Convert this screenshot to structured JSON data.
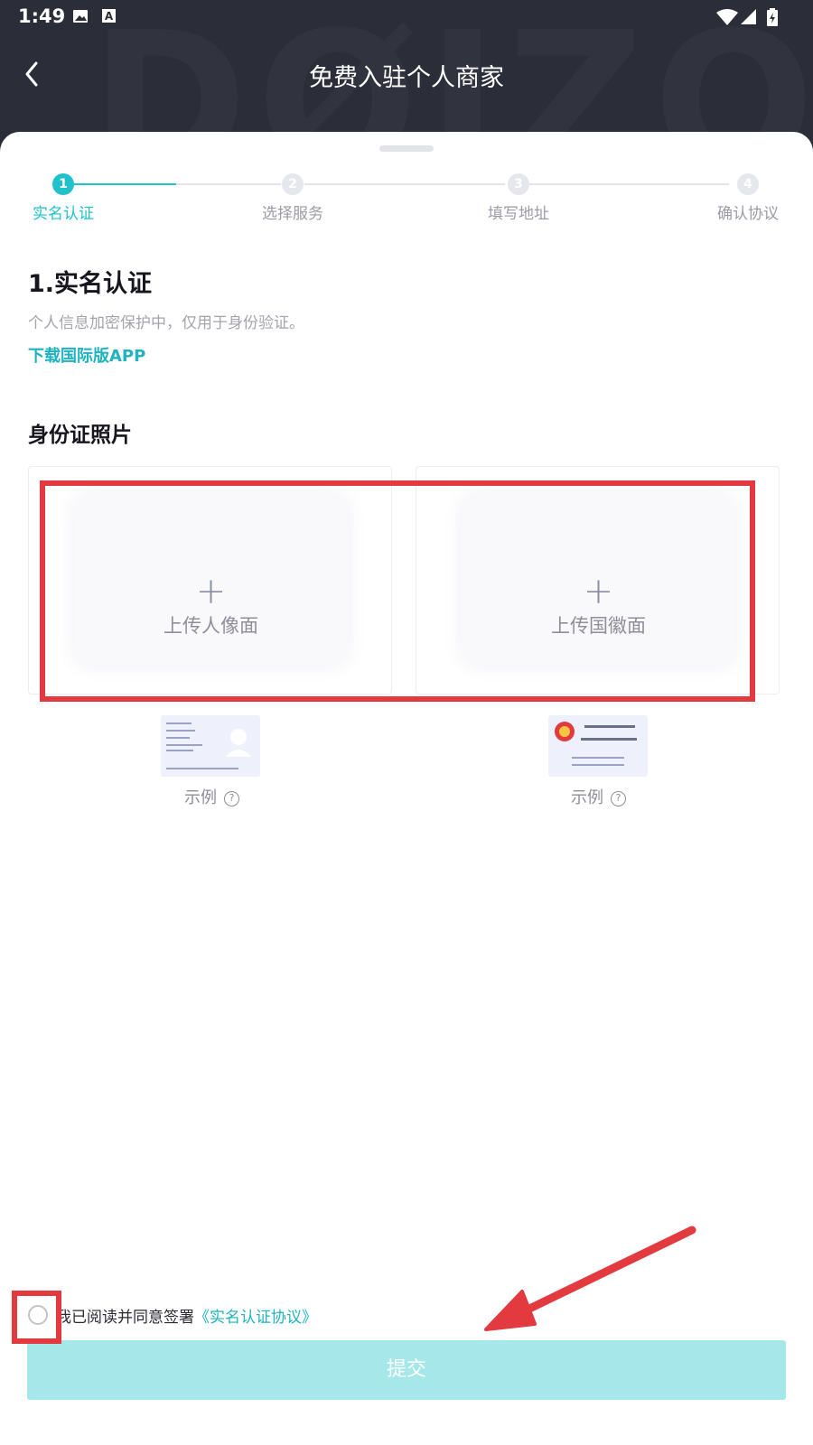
{
  "status_bar": {
    "time": "1:49",
    "icons": [
      "image-icon",
      "a-icon",
      "wifi-icon",
      "signal-icon",
      "battery-icon"
    ]
  },
  "header": {
    "title": "免费入驻个人商家",
    "back_icon": "chevron-left-icon"
  },
  "steps": [
    {
      "num": "1",
      "label": "实名认证",
      "active": true
    },
    {
      "num": "2",
      "label": "选择服务",
      "active": false
    },
    {
      "num": "3",
      "label": "填写地址",
      "active": false
    },
    {
      "num": "4",
      "label": "确认协议",
      "active": false
    }
  ],
  "section": {
    "title": "1.实名认证",
    "description": "个人信息加密保护中，仅用于身份验证。",
    "download_link": "下载国际版APP"
  },
  "id_photos": {
    "title": "身份证照片",
    "upload_front_label": "上传人像面",
    "upload_back_label": "上传国徽面",
    "example_label": "示例"
  },
  "agreement": {
    "text": "我已阅读并同意签署",
    "link": "《实名认证协议》",
    "checked": false
  },
  "submit_label": "提交",
  "colors": {
    "accent": "#1fc1ca",
    "header_bg": "#2b2d38",
    "submit_disabled": "#a6e8ea",
    "annotation": "#e23a3e"
  }
}
